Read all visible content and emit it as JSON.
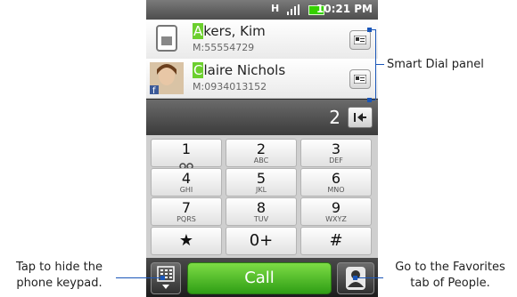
{
  "status": {
    "network": "H",
    "time": "10:21 PM"
  },
  "smart_dial": {
    "contacts": [
      {
        "first_letter": "A",
        "rest_name": "kers, Kim",
        "number": "M:55554729",
        "icon": "sim-card-icon"
      },
      {
        "first_letter": "C",
        "rest_name": "laire Nichols",
        "number": "M:0934013152",
        "icon": "contact-photo",
        "badge": "f"
      }
    ]
  },
  "dial": {
    "digits": "2"
  },
  "keypad": {
    "keys": [
      {
        "digit": "1",
        "letters": ""
      },
      {
        "digit": "2",
        "letters": "ABC"
      },
      {
        "digit": "3",
        "letters": "DEF"
      },
      {
        "digit": "4",
        "letters": "GHI"
      },
      {
        "digit": "5",
        "letters": "JKL"
      },
      {
        "digit": "6",
        "letters": "MNO"
      },
      {
        "digit": "7",
        "letters": "PQRS"
      },
      {
        "digit": "8",
        "letters": "TUV"
      },
      {
        "digit": "9",
        "letters": "WXYZ"
      },
      {
        "digit": "★",
        "letters": ""
      },
      {
        "digit": "0+",
        "letters": ""
      },
      {
        "digit": "#",
        "letters": ""
      }
    ]
  },
  "bottom_bar": {
    "call_label": "Call"
  },
  "callouts": {
    "smart_dial": "Smart Dial panel",
    "hide_keypad": "Tap to hide the phone keypad.",
    "favorites": "Go to the Favorites tab of People."
  },
  "colors": {
    "call_green": "#3fb51f",
    "highlight": "#6ccf2e",
    "callout_line": "#1a56b8"
  }
}
